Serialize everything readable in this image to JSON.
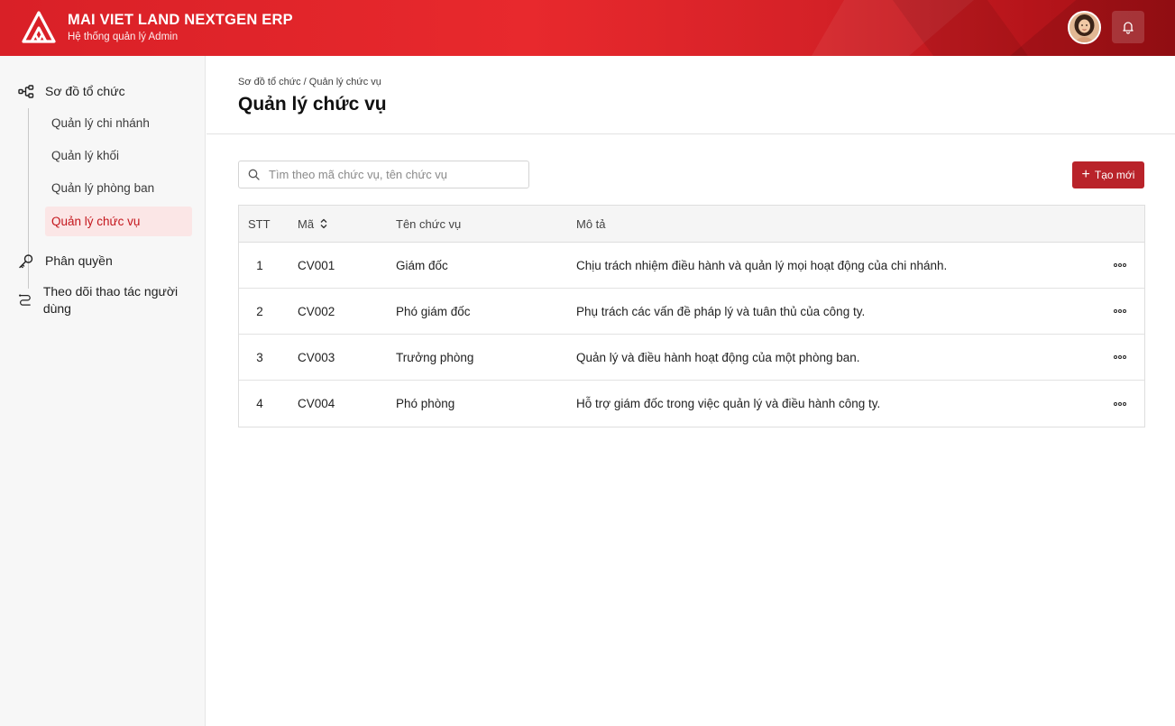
{
  "header": {
    "brand_title": "MAI VIET LAND NEXTGEN ERP",
    "brand_subtitle": "Hệ thống quản lý Admin",
    "colors": {
      "primary": "#d92027",
      "accent_button": "#b9232a"
    }
  },
  "sidebar": {
    "groups": [
      {
        "label": "Sơ đồ tổ chức",
        "icon": "org-chart-icon"
      },
      {
        "label": "Phân quyền",
        "icon": "key-icon"
      },
      {
        "label": "Theo dõi thao tác người dùng",
        "icon": "route-icon"
      }
    ],
    "sub_items": [
      {
        "label": "Quản lý chi nhánh",
        "active": false
      },
      {
        "label": "Quản lý khối",
        "active": false
      },
      {
        "label": "Quản lý phòng ban",
        "active": false
      },
      {
        "label": "Quản lý chức vụ",
        "active": true
      }
    ]
  },
  "main": {
    "breadcrumb": "Sơ đồ tổ chức / Quản lý chức vụ",
    "title": "Quản lý chức vụ",
    "search": {
      "placeholder": "Tìm theo mã chức vụ, tên chức vụ",
      "value": ""
    },
    "create_button": "Tạo mới",
    "table": {
      "headers": {
        "stt": "STT",
        "ma": "Mã",
        "ten": "Tên chức vụ",
        "mota": "Mô tả"
      },
      "rows": [
        {
          "stt": "1",
          "ma": "CV001",
          "ten": "Giám đốc",
          "mota": "Chịu trách nhiệm điều hành và quản lý mọi hoạt động của chi nhánh."
        },
        {
          "stt": "2",
          "ma": "CV002",
          "ten": "Phó giám đốc",
          "mota": "Phụ trách các vấn đề pháp lý và tuân thủ của công ty."
        },
        {
          "stt": "3",
          "ma": "CV003",
          "ten": "Trưởng phòng",
          "mota": "Quản lý và điều hành hoạt động của một phòng ban."
        },
        {
          "stt": "4",
          "ma": "CV004",
          "ten": "Phó phòng",
          "mota": "Hỗ trợ giám đốc trong việc quản lý và điều hành công ty."
        }
      ]
    }
  }
}
